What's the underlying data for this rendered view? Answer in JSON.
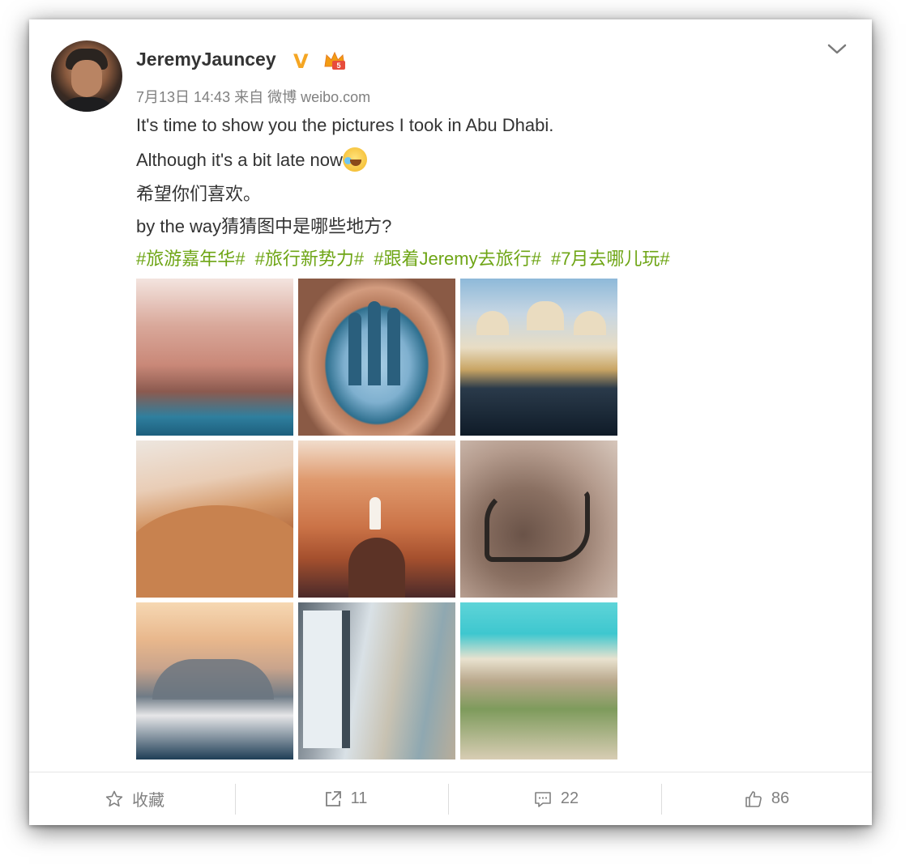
{
  "post": {
    "username": "JeremyJauncey",
    "verified_badge": "V",
    "meta": "7月13日 14:43 来自 微博 weibo.com",
    "lines": [
      "It's time to show you the pictures I took in Abu Dhabi.",
      "Although it's a bit late now",
      "希望你们喜欢。",
      "by the way猜猜图中是哪些地方?"
    ],
    "hashtags": [
      "#旅游嘉年华#",
      "#旅行新势力#",
      "#跟着Jeremy去旅行#",
      "#7月去哪儿玩#"
    ],
    "emoji": "laugh-cry-emoji"
  },
  "colors": {
    "hashtag": "#6ea515",
    "badge": "#f5a623",
    "text": "#333333",
    "meta": "#808080"
  },
  "actions": {
    "favorite_label": "收藏",
    "repost_count": "11",
    "comment_count": "22",
    "like_count": "86"
  },
  "icons": [
    "avatar",
    "verified-v-icon",
    "vip-crown-icon",
    "chevron-down-icon",
    "star-icon",
    "share-icon",
    "comment-icon",
    "thumbs-up-icon"
  ]
}
